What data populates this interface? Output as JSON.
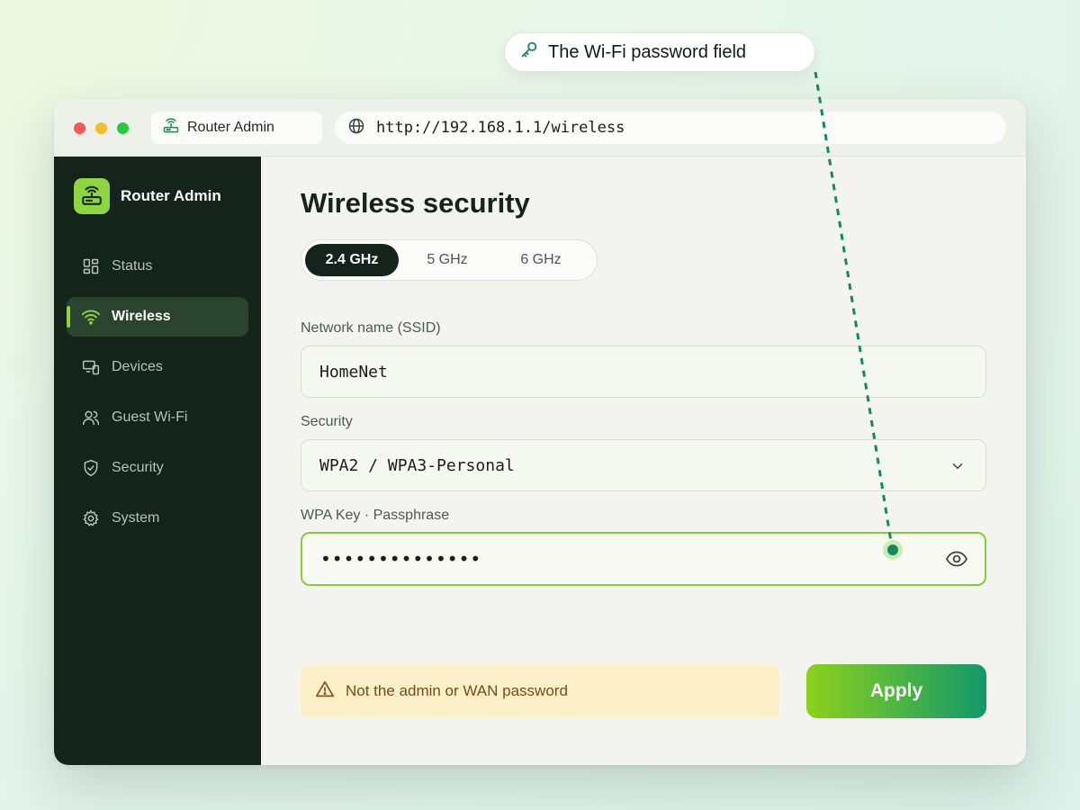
{
  "callout": {
    "text": "The Wi-Fi password field",
    "icon": "key-icon"
  },
  "browser": {
    "tab_title": "Router Admin",
    "url": "http://192.168.1.1/wireless",
    "traffic_lights": [
      "#ee5e56",
      "#f5bd2e",
      "#28c83f"
    ]
  },
  "sidebar": {
    "brand": "Router Admin",
    "items": [
      {
        "label": "Status",
        "icon": "grid-icon",
        "active": false
      },
      {
        "label": "Wireless",
        "icon": "wifi-icon",
        "active": true
      },
      {
        "label": "Devices",
        "icon": "devices-icon",
        "active": false
      },
      {
        "label": "Guest Wi-Fi",
        "icon": "users-icon",
        "active": false
      },
      {
        "label": "Security",
        "icon": "shield-icon",
        "active": false
      },
      {
        "label": "System",
        "icon": "gear-icon",
        "active": false
      }
    ]
  },
  "main": {
    "title": "Wireless security",
    "bands": [
      {
        "label": "2.4 GHz",
        "active": true
      },
      {
        "label": "5 GHz",
        "active": false
      },
      {
        "label": "6 GHz",
        "active": false
      }
    ],
    "ssid": {
      "label": "Network name (SSID)",
      "value": "HomeNet"
    },
    "security": {
      "label": "Security",
      "value": "WPA2 / WPA3-Personal"
    },
    "passphrase": {
      "label": "WPA Key · Passphrase",
      "masked_value": "••••••••••••••"
    },
    "warning": "Not the admin or WAN password",
    "apply_label": "Apply"
  },
  "colors": {
    "accent": "#8dd63f",
    "sidebar_bg": "#14241a",
    "focus_border": "#86cc3c",
    "marker": "#148a5a"
  }
}
